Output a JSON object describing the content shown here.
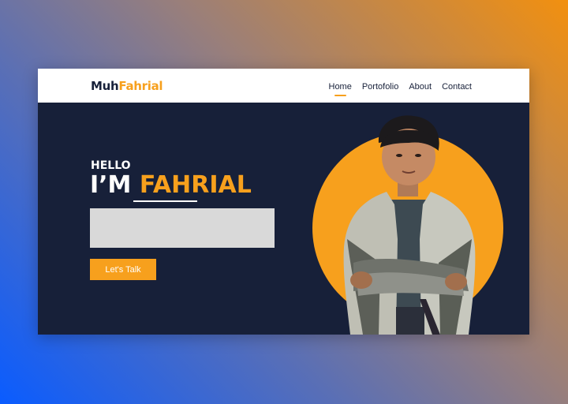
{
  "logo": {
    "part1": "Muh",
    "part2": "Fahrial"
  },
  "nav": {
    "items": [
      "Home",
      "Portofolio",
      "About",
      "Contact"
    ],
    "active": "Home"
  },
  "hero": {
    "greeting": "HELLO",
    "headline_prefix": "I’M",
    "headline_name": "FAHRIAL",
    "cta_label": "Let's Talk"
  },
  "colors": {
    "accent": "#f7a01d",
    "dark": "#172039",
    "navbar": "#ffffff",
    "placeholder_box": "#d9d9d9"
  },
  "photo": {
    "name": "profile-photo"
  }
}
